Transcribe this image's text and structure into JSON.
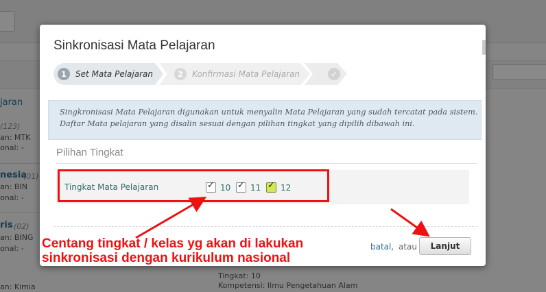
{
  "background": {
    "items": [
      {
        "title": "jaran",
        "sub": "",
        "kode": "",
        "nasional": ""
      },
      {
        "title": "",
        "sub": "(123)",
        "kode": "an: MTK",
        "nasional": "onal: -"
      },
      {
        "title": "nesia",
        "sub": "(01)",
        "kode": "an: BIN",
        "nasional": "onal: -"
      },
      {
        "title": "ris",
        "sub": "(02)",
        "kode": "an: BING",
        "nasional": "onal: -"
      }
    ],
    "last_item": "an: Kimia",
    "bottom_lines": [
      "Tingkat: 10",
      "Kompetensi: Ilmu Pengetahuan Alam"
    ]
  },
  "modal": {
    "title": "Sinkronisasi Mata Pelajaran",
    "steps": [
      {
        "num": "1",
        "label": "Set Mata Pelajaran"
      },
      {
        "num": "2",
        "label": "Konfirmasi Mata Pelajaran"
      },
      {
        "num": "✓",
        "label": ""
      }
    ],
    "info": "Singkronisasi Mata Pelajaran digunakan untuk menyalin Mata Pelajaran yang sudah tercatat pada sistem. Daftar Mata pelajaran yang disalin sesuai dengan pilihan tingkat yang dipilih dibawah ini.",
    "section_title": "Pilihan Tingkat",
    "row_label": "Tingkat Mata Pelajaran",
    "checkboxes": [
      {
        "label": "10",
        "checked": true
      },
      {
        "label": "11",
        "checked": true
      },
      {
        "label": "12",
        "checked": true
      }
    ],
    "cancel_label": "batal,",
    "or_label": "atau",
    "next_label": "Lanjut"
  },
  "annotation": {
    "line1": "Centang tingkat / kelas yg akan di lakukan",
    "line2": "sinkronisasi dengan kurikulum nasional"
  },
  "colors": {
    "annotation": "#ee1111",
    "highlight_green": "#cfe85d"
  }
}
